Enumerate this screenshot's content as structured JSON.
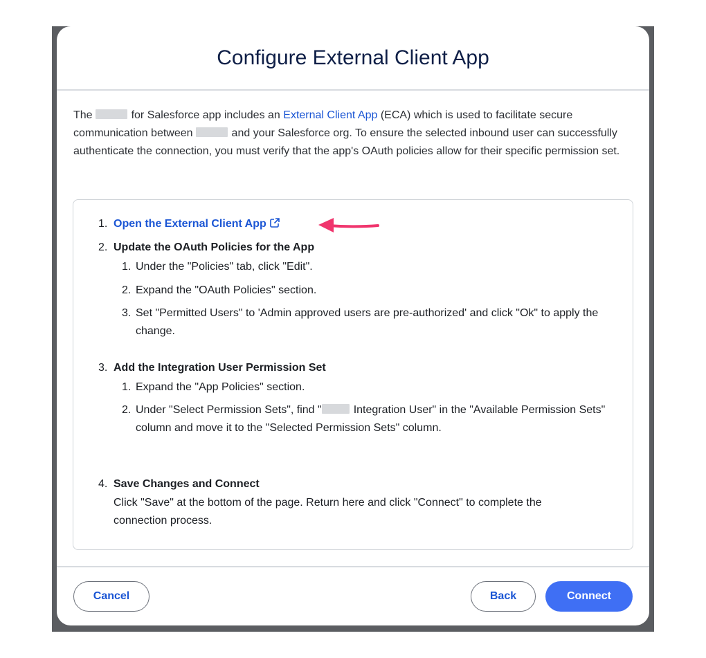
{
  "modal": {
    "title": "Configure External Client App"
  },
  "intro": {
    "part1": "The",
    "part2": "for Salesforce app includes an",
    "link": "External Client App",
    "part3": "(ECA) which is used to facilitate secure communication between",
    "part4": "and your Salesforce org. To ensure the selected inbound user can successfully authenticate the connection, you must verify that the app's OAuth policies allow for their specific permission set."
  },
  "steps": [
    {
      "num": "1.",
      "label": "Open the External Client App"
    },
    {
      "num": "2.",
      "label": "Update the OAuth Policies for the App",
      "subs": [
        {
          "num": "1.",
          "text": "Under the \"Policies\" tab, click \"Edit\"."
        },
        {
          "num": "2.",
          "text": "Expand the \"OAuth Policies\" section."
        },
        {
          "num": "3.",
          "text": "Set \"Permitted Users\" to 'Admin approved users are pre-authorized' and click \"Ok\" to apply the change."
        }
      ]
    },
    {
      "num": "3.",
      "label": "Add the Integration User Permission Set",
      "subs": [
        {
          "num": "1.",
          "text": "Expand the \"App Policies\" section."
        },
        {
          "num": "2.",
          "text_a": "Under \"Select Permission Sets\", find \"",
          "text_b": "Integration User\" in the \"Available Permission Sets\" column and move it to the \"Selected Permission Sets\" column."
        }
      ]
    },
    {
      "num": "4.",
      "label": "Save Changes and Connect",
      "text": "Click \"Save\" at the bottom of the page. Return here and click \"Connect\" to complete the connection process."
    }
  ],
  "footer": {
    "cancel": "Cancel",
    "back": "Back",
    "connect": "Connect"
  },
  "colors": {
    "link": "#1a55d4",
    "primary": "#3f6ff4",
    "arrow": "#f0356d"
  },
  "icons": {
    "external_link": "external-link-icon",
    "annotation": "arrow-icon"
  }
}
